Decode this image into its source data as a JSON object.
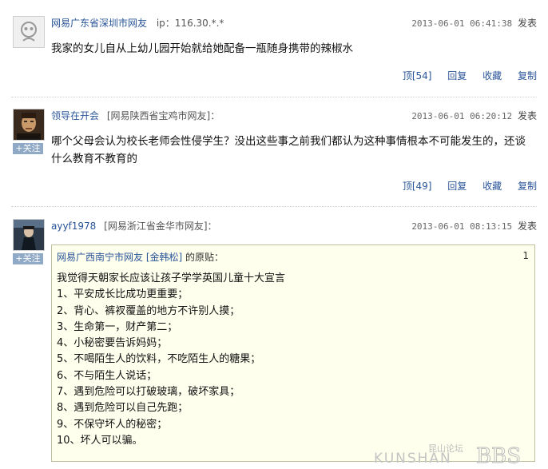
{
  "comments": [
    {
      "user": "网易广东省深圳市网友",
      "ip": "ip：116.30.*.*",
      "time": "2013-06-01 06:41:38",
      "report": "发表",
      "text": "我家的女儿自从上幼儿园开始就给她配备一瓶随身携带的辣椒水",
      "actions": {
        "up": "顶[54]",
        "reply": "回复",
        "fav": "收藏",
        "copy": "复制"
      }
    },
    {
      "user": "领导在开会",
      "location": "[网易陕西省宝鸡市网友]：",
      "time": "2013-06-01 06:20:12",
      "report": "发表",
      "follow": "+关注",
      "text": "哪个父母会认为校长老师会性侵学生？没出这些事之前我们都认为这种事情根本不可能发生的，还谈什么教育不教育的",
      "actions": {
        "up": "顶[49]",
        "reply": "回复",
        "fav": "收藏",
        "copy": "复制"
      }
    },
    {
      "user": "ayyf1978",
      "location": "[网易浙江省金华市网友]：",
      "time": "2013-06-01 08:13:15",
      "report": "发表",
      "follow": "+关注",
      "quote": {
        "source_user": "网易广西南宁市网友",
        "source_nick": "[金韩松]",
        "source_suffix": "的原贴：",
        "floor": "1",
        "lines": [
          "我觉得天朝家长应该让孩子学学英国儿童十大宣言",
          "1、平安成长比成功更重要；",
          "2、背心、裤衩覆盖的地方不许别人摸；",
          "3、生命第一，财产第二；",
          "4、小秘密要告诉妈妈；",
          "5、不喝陌生人的饮料，不吃陌生人的糖果；",
          "6、不与陌生人说话；",
          "7、遇到危险可以打破玻璃，破坏家具；",
          "8、遇到危险可以自己先跑；",
          "9、不保守坏人的秘密；",
          "10、坏人可以骗。"
        ]
      }
    }
  ],
  "watermark": {
    "cn": "昆山论坛",
    "en": "KUNSHAN",
    "mark": "BBS"
  },
  "colors": {
    "link": "#2a5599",
    "quote_bg": "#ffffee",
    "follow_bg": "#8fa9c6"
  }
}
